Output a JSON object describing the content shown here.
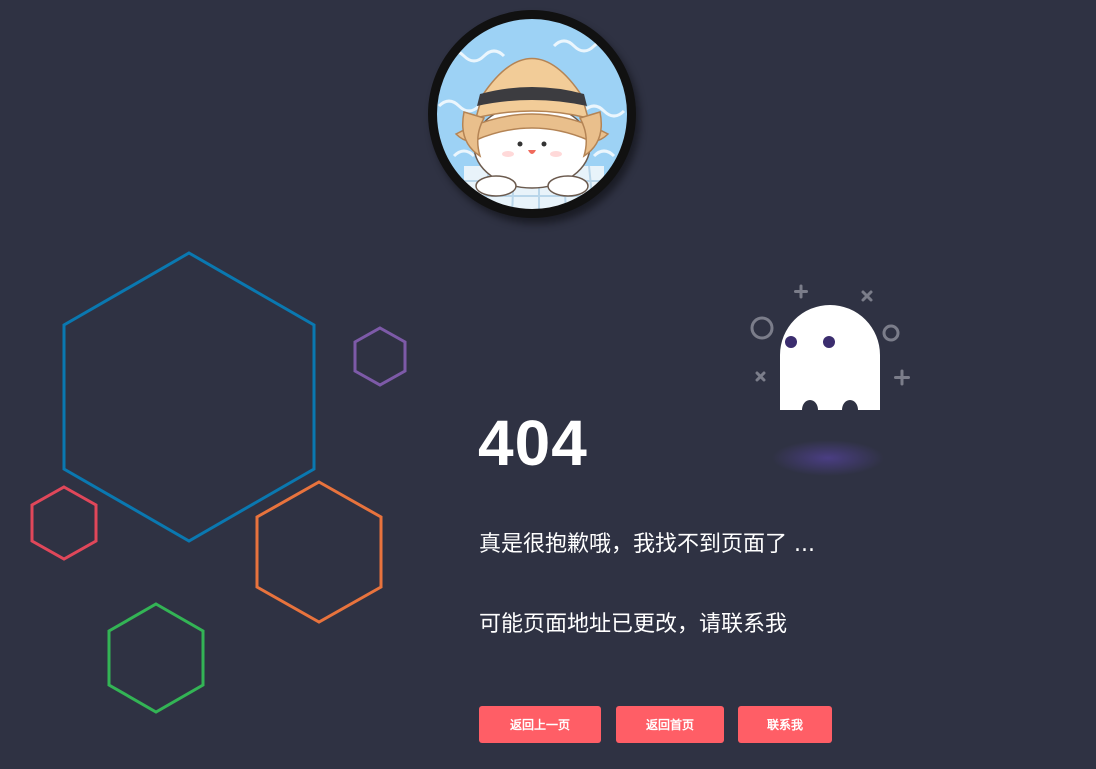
{
  "error": {
    "code": "404",
    "message_primary": "真是很抱歉哦，我找不到页面了 ...",
    "message_secondary": "可能页面地址已更改，请联系我"
  },
  "buttons": {
    "back_label": "返回上一页",
    "home_label": "返回首页",
    "contact_label": "联系我"
  },
  "colors": {
    "background": "#2f3243",
    "button": "#ff5e66",
    "hex_blue": "#0a78b0",
    "hex_purple": "#7d5aa8",
    "hex_red": "#e0475a",
    "hex_orange": "#e8733d",
    "hex_green": "#33b455",
    "ghost": "#ffffff",
    "ghost_eyes": "#3b2d6e",
    "sparkle": "#7b7d8a"
  },
  "icons": {
    "avatar": "avatar-image",
    "ghost": "ghost-icon"
  }
}
